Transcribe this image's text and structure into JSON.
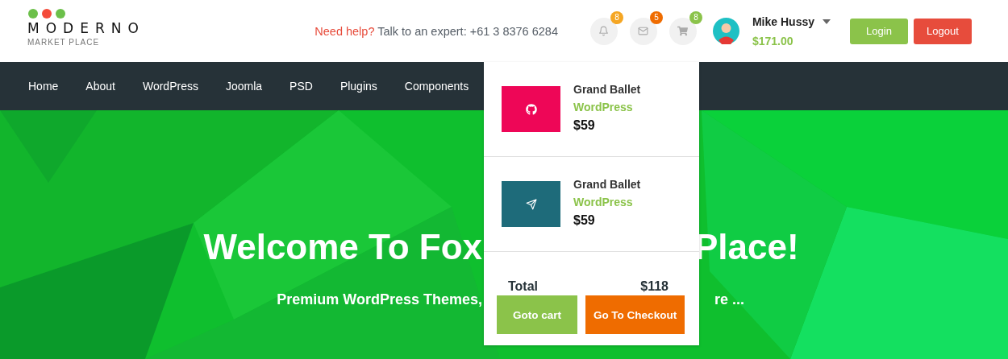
{
  "logo": {
    "dots": [
      {
        "color": "#6cc04a"
      },
      {
        "color": "#f44b3a"
      },
      {
        "color": "#6cc04a"
      }
    ],
    "name": "MODERNO",
    "tagline": "MARKET PLACE"
  },
  "help": {
    "lead": "Need help?",
    "text": "Talk to an expert: +61 3 8376 6284"
  },
  "icons": [
    {
      "kind": "bell",
      "count": "8",
      "color": "#f5a623"
    },
    {
      "kind": "mail",
      "count": "5",
      "color": "#ef6c00"
    },
    {
      "kind": "cart",
      "count": "8",
      "color": "#8bc34a"
    }
  ],
  "user": {
    "name": "Mike Hussy",
    "balance": "$171.00"
  },
  "buttons": [
    {
      "label": "Login",
      "kind": "login"
    },
    {
      "label": "Logout",
      "kind": "logout"
    }
  ],
  "nav": [
    "Home",
    "About",
    "WordPress",
    "Joomla",
    "PSD",
    "Plugins",
    "Components"
  ],
  "hero": {
    "title_left": "Welcome To Fox",
    "title_right": "Place!",
    "subtitle_left": "Premium WordPress Themes,",
    "subtitle_right": "re ..."
  },
  "cart": {
    "items": [
      {
        "name": "Grand Ballet",
        "category": "WordPress",
        "price": "$59",
        "kind": "github",
        "color": "#ee0657"
      },
      {
        "name": "Grand Ballet",
        "category": "WordPress",
        "price": "$59",
        "kind": "send",
        "color": "#1e6b7a"
      }
    ],
    "total_label": "Total",
    "total": "$118",
    "buttons": [
      {
        "label": "Goto cart",
        "kind": "cart"
      },
      {
        "label": "Go To Checkout",
        "kind": "checkout"
      }
    ]
  }
}
